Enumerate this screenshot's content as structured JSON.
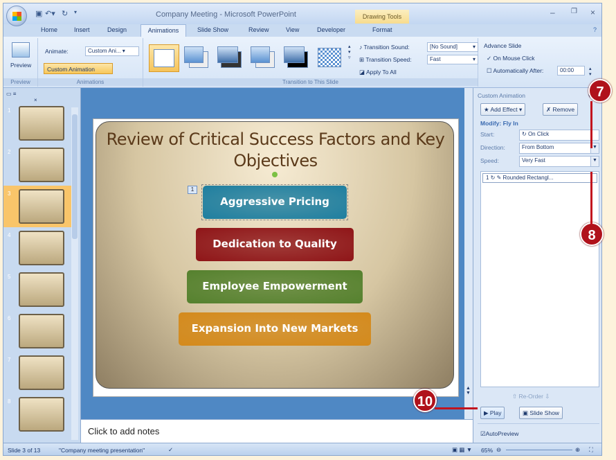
{
  "window": {
    "title": "Company Meeting - Microsoft PowerPoint",
    "context_tab": "Drawing Tools"
  },
  "tabs": [
    "Home",
    "Insert",
    "Design",
    "Animations",
    "Slide Show",
    "Review",
    "View",
    "Developer",
    "Format"
  ],
  "active_tab": "Animations",
  "ribbon": {
    "preview": {
      "button": "Preview",
      "group": "Preview"
    },
    "animations": {
      "animate_label": "Animate:",
      "animate_value": "Custom Ani...",
      "custom_animation": "Custom Animation",
      "group": "Animations"
    },
    "transition": {
      "sound_label": "Transition Sound:",
      "sound_value": "[No Sound]",
      "speed_label": "Transition Speed:",
      "speed_value": "Fast",
      "apply_all": "Apply To All",
      "group": "Transition to This Slide"
    },
    "advance": {
      "title": "Advance Slide",
      "on_click": "On Mouse Click",
      "on_click_checked": true,
      "auto_after": "Automatically After:",
      "auto_after_checked": false,
      "time": "00:00"
    }
  },
  "slide_panel": {
    "slides": [
      "1",
      "2",
      "3",
      "4",
      "5",
      "6",
      "7",
      "8"
    ],
    "selected": "3"
  },
  "slide": {
    "title": "Review of Critical Success Factors and Key Objectives",
    "anim_tag": "1",
    "shapes": [
      {
        "text": "Aggressive Pricing",
        "color": "#1f7fa0"
      },
      {
        "text": "Dedication to Quality",
        "color": "#8f1518"
      },
      {
        "text": "Employee Empowerment",
        "color": "#55812e"
      },
      {
        "text": "Expansion Into New Markets",
        "color": "#d48a1c"
      }
    ]
  },
  "notes": {
    "placeholder": "Click to add notes"
  },
  "pane": {
    "title": "Custom Animation",
    "add_effect": "Add Effect",
    "remove": "Remove",
    "modify": "Modify: Fly In",
    "start_label": "Start:",
    "start_value": "On Click",
    "direction_label": "Direction:",
    "direction_value": "From Bottom",
    "speed_label": "Speed:",
    "speed_value": "Very Fast",
    "list_item_num": "1",
    "list_item": "Rounded Rectangl...",
    "reorder": "Re-Order",
    "play": "Play",
    "slide_show": "Slide Show",
    "autopreview": "AutoPreview",
    "autopreview_checked": true
  },
  "status": {
    "slide": "Slide 3 of 13",
    "theme": "\"Company meeting presentation\"",
    "zoom": "65%"
  },
  "callouts": [
    "7",
    "8",
    "10"
  ]
}
